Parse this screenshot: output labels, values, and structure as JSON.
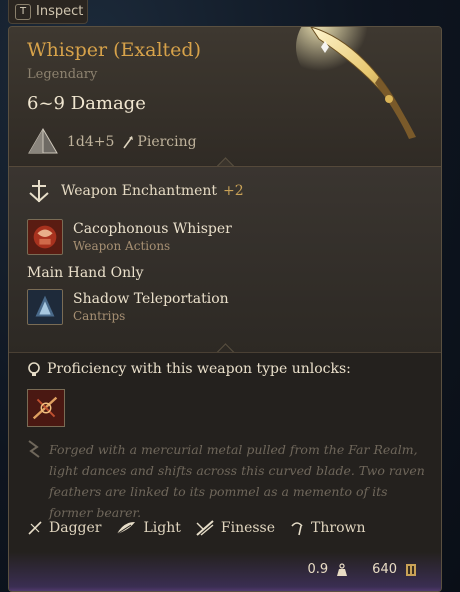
{
  "inspect_tab": {
    "key": "T",
    "label": "Inspect"
  },
  "item": {
    "name": "Whisper (Exalted)",
    "rarity": "Legendary",
    "damage": "6~9 Damage",
    "dice": "1d4+5",
    "damage_type": "Piercing"
  },
  "enchantment": {
    "label": "Weapon Enchantment",
    "bonus": "+2"
  },
  "abilities": [
    {
      "name": "Cacophonous Whisper",
      "category": "Weapon Actions"
    },
    {
      "name": "Shadow Teleportation",
      "category": "Cantrips"
    }
  ],
  "main_hand": "Main Hand Only",
  "proficiency": {
    "label": "Proficiency with this weapon type unlocks:"
  },
  "lore": "Forged with a mercurial metal pulled from the Far Realm, light dances and shifts across this curved blade. Two raven feathers are linked to its pommel as a memento of its former bearer.",
  "properties": [
    {
      "label": "Dagger",
      "icon": "dagger-icon"
    },
    {
      "label": "Light",
      "icon": "feather-icon"
    },
    {
      "label": "Finesse",
      "icon": "finesse-icon"
    },
    {
      "label": "Thrown",
      "icon": "thrown-icon"
    }
  ],
  "footer": {
    "weight": "0.9",
    "value": "640"
  },
  "colors": {
    "legendary": "#d7a24a",
    "panel_bg": "#2b2722",
    "accent_purple": "#5a3e7a"
  }
}
